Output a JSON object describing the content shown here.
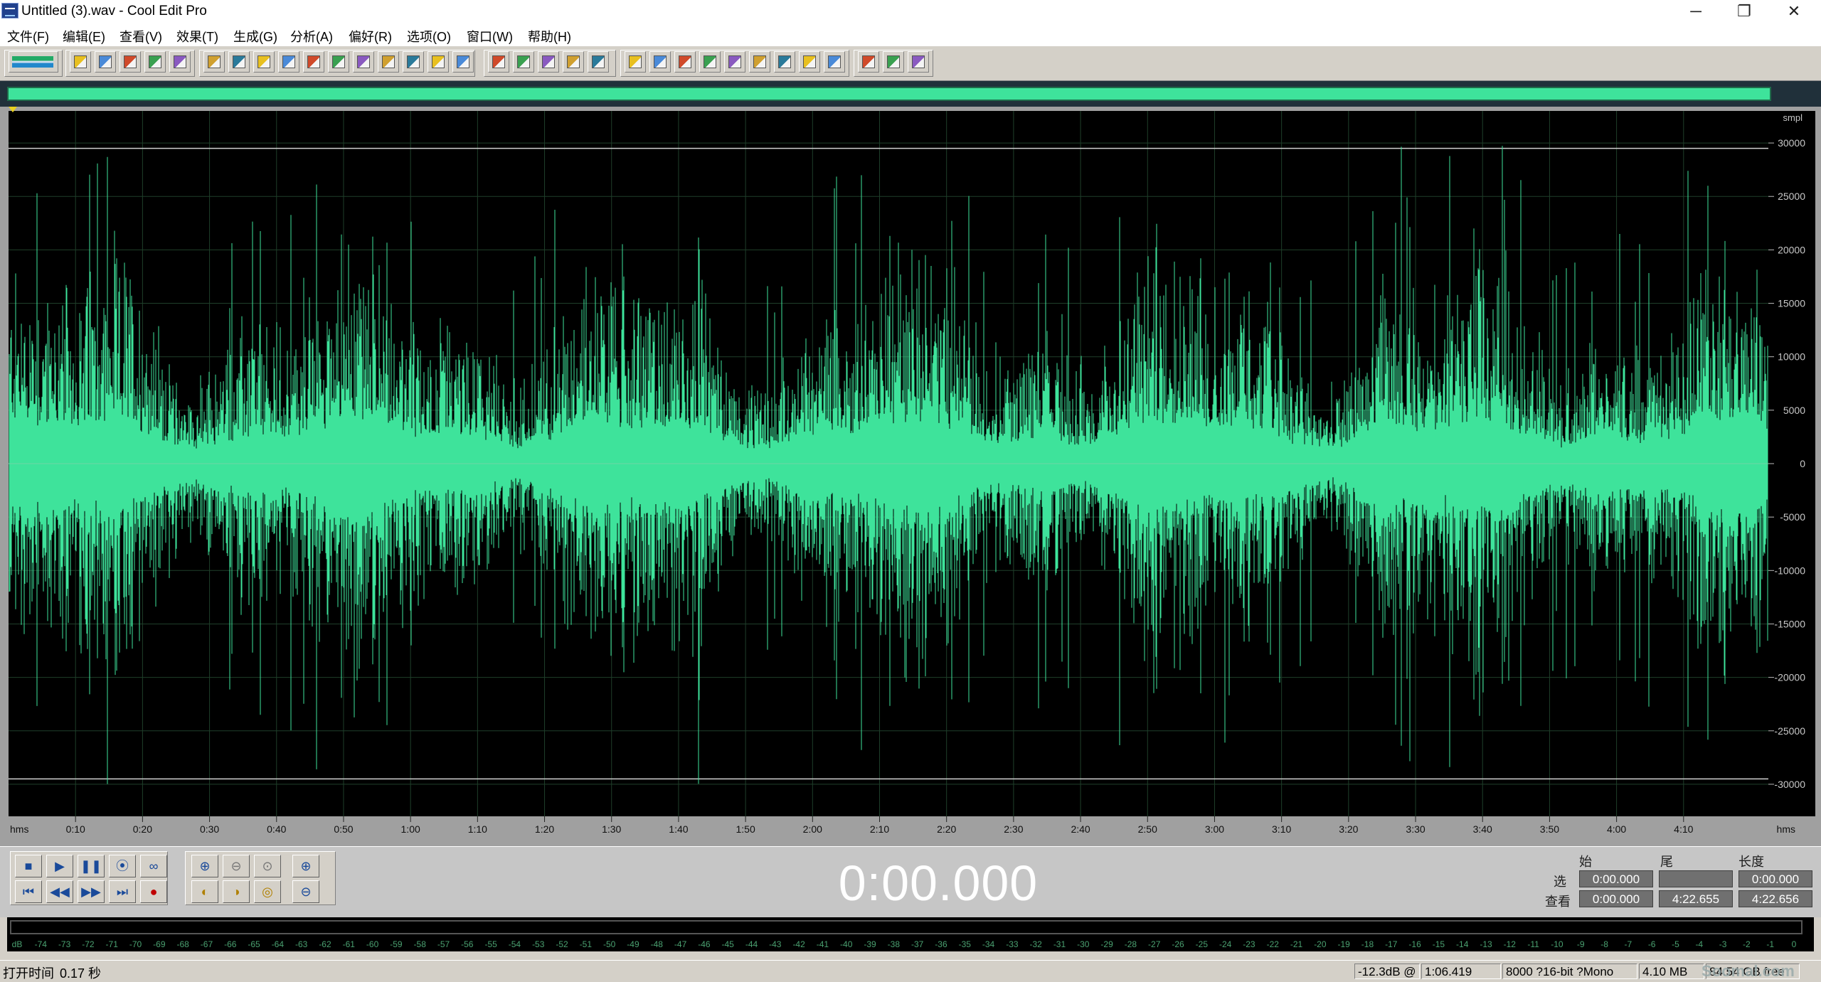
{
  "window": {
    "title": "Untitled (3).wav - Cool Edit Pro",
    "minimize_glyph": "─",
    "restore_glyph": "❐",
    "close_glyph": "✕"
  },
  "menu": [
    {
      "label": "文件(F)"
    },
    {
      "label": "编辑(E)"
    },
    {
      "label": "查看(V)"
    },
    {
      "label": "效果(T)"
    },
    {
      "label": "生成(G)"
    },
    {
      "label": "分析(A)"
    },
    {
      "label": "偏好(R)"
    },
    {
      "label": "选项(O)"
    },
    {
      "label": "窗口(W)"
    },
    {
      "label": "帮助(H)"
    }
  ],
  "toolbar_icons": {
    "group1": [
      "waveform-edit-view-icon"
    ],
    "group2": [
      "new-file-icon",
      "open-file-icon",
      "save-file-icon",
      "save-all-icon",
      "close-file-icon"
    ],
    "group3": [
      "undo-icon",
      "redo-icon",
      "repeat-last-icon",
      "copy-new-icon",
      "copy-icon",
      "cut-icon",
      "paste-icon",
      "paste-new-icon",
      "mix-paste-icon",
      "trim-icon",
      "crop-icon"
    ],
    "group4": [
      "spectral-view-icon",
      "envelope-icon",
      "amplify-icon",
      "normalize-icon",
      "fade-icon"
    ],
    "group5": [
      "cue-list-icon",
      "play-list-icon",
      "info-icon",
      "loop-icon",
      "find-icon",
      "time-display-icon",
      "frequency-analysis-icon",
      "statistics-icon",
      "settings-icon"
    ],
    "group6": [
      "scripts-icon",
      "options-icon",
      "help-icon"
    ]
  },
  "waveform": {
    "color": "#3ee39b",
    "background": "#000000",
    "y_axis_unit": "smpl",
    "y_ticks": [
      "30000",
      "25000",
      "20000",
      "15000",
      "10000",
      "5000",
      "0",
      "-5000",
      "-10000",
      "-15000",
      "-20000",
      "-25000",
      "-30000"
    ],
    "x_axis_unit": "hms",
    "x_ticks": [
      "0:10",
      "0:20",
      "0:30",
      "0:40",
      "0:50",
      "1:00",
      "1:10",
      "1:20",
      "1:30",
      "1:40",
      "1:50",
      "2:00",
      "2:10",
      "2:20",
      "2:30",
      "2:40",
      "2:50",
      "3:00",
      "3:10",
      "3:20",
      "3:30",
      "3:40",
      "3:50",
      "4:00",
      "4:10"
    ],
    "x_unit_right": "hms"
  },
  "transport": {
    "stop": "■",
    "play": "▶",
    "pause": "❚❚",
    "play_to_end": "⦿",
    "loop": "∞",
    "go_start": "⏮",
    "rewind": "◀◀",
    "fast_forward": "▶▶",
    "go_end": "⏭",
    "record": "●"
  },
  "time_display": "0:00.000",
  "selection": {
    "col_begin": "始",
    "col_end": "尾",
    "col_length": "长度",
    "row_sel": "选",
    "row_view": "查看",
    "sel_begin": "0:00.000",
    "sel_end": "",
    "sel_length": "0:00.000",
    "view_begin": "0:00.000",
    "view_end": "4:22.655",
    "view_length": "4:22.656"
  },
  "meter": {
    "ticks": [
      "dB",
      "-74",
      "-73",
      "-72",
      "-71",
      "-70",
      "-69",
      "-68",
      "-67",
      "-66",
      "-65",
      "-64",
      "-63",
      "-62",
      "-61",
      "-60",
      "-59",
      "-58",
      "-57",
      "-56",
      "-55",
      "-54",
      "-53",
      "-52",
      "-51",
      "-50",
      "-49",
      "-48",
      "-47",
      "-46",
      "-45",
      "-44",
      "-43",
      "-42",
      "-41",
      "-40",
      "-39",
      "-38",
      "-37",
      "-36",
      "-35",
      "-34",
      "-33",
      "-32",
      "-31",
      "-30",
      "-29",
      "-28",
      "-27",
      "-26",
      "-25",
      "-24",
      "-23",
      "-22",
      "-21",
      "-20",
      "-19",
      "-18",
      "-17",
      "-16",
      "-15",
      "-14",
      "-13",
      "-12",
      "-11",
      "-10",
      "-9",
      "-8",
      "-7",
      "-6",
      "-5",
      "-4",
      "-3",
      "-2",
      "-1",
      "0"
    ]
  },
  "status": {
    "open_time": "打开时间",
    "open_time_value": "0.17 秒",
    "level": "-12.3dB @",
    "position": "1:06.419",
    "format": "8000 ?16-bit ?Mono",
    "file_size": "4.10 MB",
    "disk_free": "84.54 GB free",
    "watermark": "Soomal.com"
  }
}
